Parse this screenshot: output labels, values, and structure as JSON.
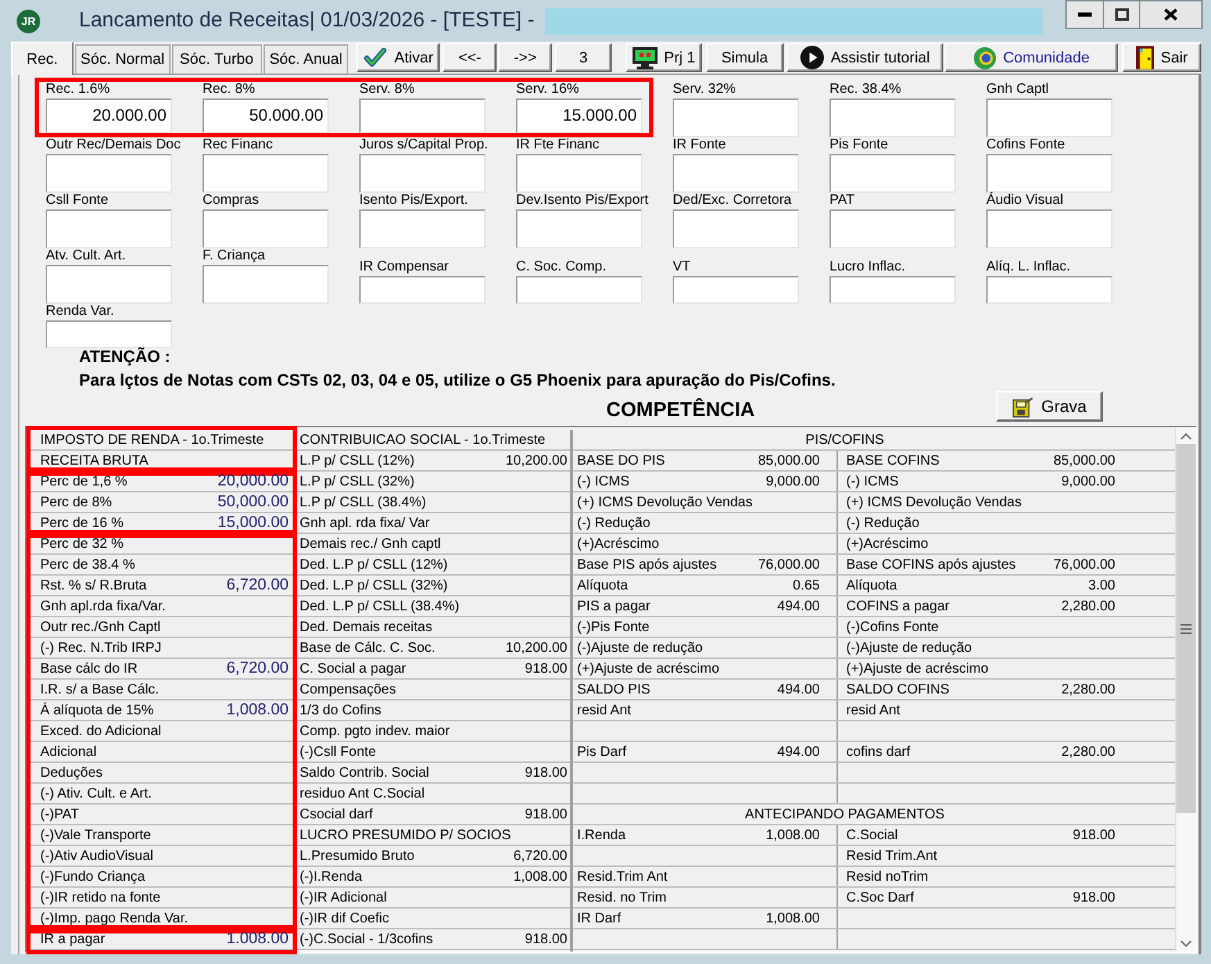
{
  "window": {
    "logo": "JR",
    "title": "Lancamento de Receitas| 01/03/2026 - [TESTE] -"
  },
  "tabs": [
    {
      "label": "Rec.",
      "selected": true
    },
    {
      "label": "Sóc. Normal",
      "selected": false
    },
    {
      "label": "Sóc. Turbo",
      "selected": false
    },
    {
      "label": "Sóc. Anual",
      "selected": false
    }
  ],
  "toolbar": [
    {
      "kind": "check",
      "label": "Ativar"
    },
    {
      "kind": "plain",
      "label": "<<-"
    },
    {
      "kind": "plain",
      "label": "->>"
    },
    {
      "kind": "plain",
      "label": "3"
    },
    {
      "kind": "monitor",
      "label": "Prj 1"
    },
    {
      "kind": "plain",
      "label": "Simula"
    },
    {
      "kind": "play",
      "label": "Assistir tutorial"
    },
    {
      "kind": "community",
      "label": "Comunidade"
    },
    {
      "kind": "exit",
      "label": "Sair"
    }
  ],
  "field_rows": [
    {
      "groups": [
        {
          "highlighted": true,
          "fields": [
            {
              "kind": "tall",
              "label": "Rec. 1.6%",
              "value": "20.000.00"
            },
            {
              "kind": "tall",
              "label": "Rec. 8%",
              "value": "50.000.00"
            },
            {
              "kind": "tall",
              "label": "Serv. 8%"
            },
            {
              "kind": "tall",
              "label": "Serv. 16%",
              "value": "15.000.00"
            }
          ]
        },
        {
          "highlighted": false,
          "fields": [
            {
              "kind": "tall",
              "label": "Serv. 32%"
            },
            {
              "kind": "tall",
              "label": "Rec. 38.4%"
            },
            {
              "kind": "tall",
              "label": "Gnh Captl"
            }
          ]
        }
      ]
    },
    {
      "groups": [
        {
          "highlighted": false,
          "fields": [
            {
              "kind": "tall",
              "label": "Outr Rec/Demais Doc"
            },
            {
              "kind": "tall",
              "label": "Rec Financ"
            },
            {
              "kind": "tall",
              "label": "Juros s/Capital Prop."
            },
            {
              "kind": "tall",
              "label": "IR Fte Financ"
            },
            {
              "kind": "tall",
              "label": "IR Fonte"
            },
            {
              "kind": "tall",
              "label": "Pis Fonte"
            },
            {
              "kind": "tall",
              "label": "Cofins Fonte"
            }
          ]
        }
      ]
    },
    {
      "groups": [
        {
          "highlighted": false,
          "fields": [
            {
              "kind": "tall",
              "label": "Csll Fonte"
            },
            {
              "kind": "tall",
              "label": "Compras"
            },
            {
              "kind": "tall",
              "label": "Isento Pis/Export."
            },
            {
              "kind": "tall",
              "label": "Dev.Isento Pis/Export"
            },
            {
              "kind": "tall",
              "label": "Ded/Exc. Corretora"
            },
            {
              "kind": "tall",
              "label": "PAT"
            },
            {
              "kind": "tall",
              "label": "Áudio Visual"
            }
          ]
        }
      ]
    },
    {
      "groups": [
        {
          "highlighted": false,
          "fields": [
            {
              "kind": "tall",
              "label": "Atv. Cult. Art."
            },
            {
              "kind": "tall",
              "label": "F. Criança"
            },
            {
              "kind": "short",
              "label": "IR Compensar"
            },
            {
              "kind": "short",
              "label": "C. Soc. Comp."
            },
            {
              "kind": "short",
              "label": "VT"
            },
            {
              "kind": "short",
              "label": "Lucro Inflac."
            },
            {
              "kind": "short",
              "label": "Alíq. L. Inflac."
            }
          ]
        }
      ]
    },
    {
      "groups": [
        {
          "highlighted": false,
          "fields": [
            {
              "kind": "short",
              "label": "Renda Var."
            }
          ]
        }
      ]
    }
  ],
  "notice": {
    "title": "ATENÇÃO :",
    "text": "Para lçtos de Notas com CSTs 02, 03, 04 e 05, utilize o G5 Phoenix para apuração do Pis/Cofins."
  },
  "section_title": "COMPETÊNCIA",
  "save_button": {
    "label": "Grava"
  },
  "income_tax": {
    "groups": [
      {
        "highlighted": true,
        "rows": [
          {
            "label": "IMPOSTO DE RENDA - 1o.Trimeste"
          },
          {
            "label": "RECEITA BRUTA"
          }
        ]
      },
      {
        "highlighted": true,
        "rows": [
          {
            "label": "Perc de 1,6 %",
            "value": "20,000.00"
          },
          {
            "label": "Perc de 8%",
            "value": "50,000.00"
          },
          {
            "label": "Perc de 16 %",
            "value": "15,000.00"
          }
        ]
      },
      {
        "highlighted": true,
        "rows": [
          {
            "label": "Perc de 32 %"
          },
          {
            "label": "Perc de 38.4 %"
          },
          {
            "label": "Rst. % s/ R.Bruta",
            "value": "6,720.00"
          },
          {
            "label": "Gnh apl.rda fixa/Var."
          },
          {
            "label": "Outr rec./Gnh Captl"
          },
          {
            "label": "(-) Rec. N.Trib IRPJ"
          },
          {
            "label": "Base cálc do IR",
            "value": "6,720.00"
          },
          {
            "label": "I.R. s/ a Base Cálc."
          },
          {
            "label": "Á alíquota de 15%",
            "value": "1,008.00"
          },
          {
            "label": "Exced. do Adicional"
          },
          {
            "label": "Adicional"
          },
          {
            "label": "Deduções"
          },
          {
            "label": "(-) Ativ. Cult. e Art."
          },
          {
            "label": "(-)PAT"
          },
          {
            "label": "(-)Vale Transporte"
          },
          {
            "label": "(-)Ativ AudioVisual"
          },
          {
            "label": "(-)Fundo Criança"
          },
          {
            "label": "(-)IR retido na fonte"
          },
          {
            "label": "(-)Imp. pago Renda Var."
          }
        ]
      },
      {
        "highlighted": true,
        "rows": [
          {
            "label": "IR a pagar",
            "value": "1.008.00"
          }
        ]
      }
    ]
  },
  "social_contribution": {
    "rows": [
      {
        "label": "CONTRIBUICAO SOCIAL - 1o.Trimeste"
      },
      {
        "label": "L.P p/ CSLL (12%)",
        "value": "10,200.00"
      },
      {
        "label": "L.P p/ CSLL (32%)"
      },
      {
        "label": "L.P p/ CSLL (38.4%)"
      },
      {
        "label": "Gnh apl. rda fixa/ Var"
      },
      {
        "label": "Demais rec./ Gnh captl"
      },
      {
        "label": "Ded. L.P p/ CSLL (12%)"
      },
      {
        "label": "Ded. L.P p/ CSLL (32%)"
      },
      {
        "label": "Ded. L.P p/ CSLL (38.4%)"
      },
      {
        "label": "Ded. Demais receitas"
      },
      {
        "label": "Base de Cálc. C. Soc.",
        "value": "10,200.00"
      },
      {
        "label": "C. Social a pagar",
        "value": "918.00"
      },
      {
        "label": "Compensações"
      },
      {
        "label": "1/3 do Cofins"
      },
      {
        "label": "Comp. pgto indev. maior"
      },
      {
        "label": "(-)Csll Fonte"
      },
      {
        "label": "Saldo Contrib. Social",
        "value": "918.00"
      },
      {
        "label": "residuo Ant C.Social"
      },
      {
        "label": "Csocial darf",
        "value": "918.00"
      },
      {
        "label": "LUCRO PRESUMIDO P/ SOCIOS"
      },
      {
        "label": "L.Presumido Bruto",
        "value": "6,720.00"
      },
      {
        "label": "(-)I.Renda",
        "value": "1,008.00"
      },
      {
        "label": "(-)IR Adicional"
      },
      {
        "label": "(-)IR dif Coefic"
      },
      {
        "label": "(-)C.Social - 1/3cofins",
        "value": "918.00"
      }
    ]
  },
  "pis_cofins": {
    "rows": [
      {
        "kind": "header",
        "label": "PIS/COFINS"
      },
      {
        "kind": "pair",
        "cells": [
          {
            "label": "BASE DO PIS",
            "value": "85,000.00"
          },
          {
            "label": "BASE COFINS",
            "value": "85,000.00"
          }
        ]
      },
      {
        "kind": "pair",
        "cells": [
          {
            "label": "(-) ICMS",
            "value": "9,000.00"
          },
          {
            "label": "(-) ICMS",
            "value": "9,000.00"
          }
        ]
      },
      {
        "kind": "pair",
        "cells": [
          {
            "label": "(+) ICMS Devolução Vendas"
          },
          {
            "label": "(+) ICMS Devolução Vendas"
          }
        ]
      },
      {
        "kind": "pair",
        "cells": [
          {
            "label": "(-) Redução"
          },
          {
            "label": "(-) Redução"
          }
        ]
      },
      {
        "kind": "pair",
        "cells": [
          {
            "label": "(+)Acréscimo"
          },
          {
            "label": "(+)Acréscimo"
          }
        ]
      },
      {
        "kind": "pair",
        "cells": [
          {
            "label": "Base PIS após ajustes",
            "value": "76,000.00"
          },
          {
            "label": "Base COFINS após ajustes",
            "value": "76,000.00"
          }
        ]
      },
      {
        "kind": "pair",
        "cells": [
          {
            "label": "Alíquota",
            "value": "0.65"
          },
          {
            "label": "Alíquota",
            "value": "3.00"
          }
        ]
      },
      {
        "kind": "pair",
        "cells": [
          {
            "label": "PIS a pagar",
            "value": "494.00"
          },
          {
            "label": "COFINS a pagar",
            "value": "2,280.00"
          }
        ]
      },
      {
        "kind": "pair",
        "cells": [
          {
            "label": "(-)Pis Fonte"
          },
          {
            "label": "(-)Cofins Fonte"
          }
        ]
      },
      {
        "kind": "pair",
        "cells": [
          {
            "label": "(-)Ajuste de redução"
          },
          {
            "label": "(-)Ajuste de redução"
          }
        ]
      },
      {
        "kind": "pair",
        "cells": [
          {
            "label": "(+)Ajuste de acréscimo"
          },
          {
            "label": "(+)Ajuste de acréscimo"
          }
        ]
      },
      {
        "kind": "pair",
        "cells": [
          {
            "label": "SALDO PIS",
            "value": "494.00"
          },
          {
            "label": "SALDO COFINS",
            "value": "2,280.00"
          }
        ]
      },
      {
        "kind": "pair",
        "cells": [
          {
            "label": "resid Ant"
          },
          {
            "label": "resid Ant"
          }
        ]
      },
      {
        "kind": "blank"
      },
      {
        "kind": "pair",
        "cells": [
          {
            "label": "Pis Darf",
            "value": "494.00"
          },
          {
            "label": "cofins darf",
            "value": "2,280.00"
          }
        ]
      },
      {
        "kind": "blank"
      },
      {
        "kind": "blank"
      },
      {
        "kind": "header",
        "label": "ANTECIPANDO PAGAMENTOS"
      },
      {
        "kind": "pair",
        "cells": [
          {
            "label": "I.Renda",
            "value": "1,008.00"
          },
          {
            "label": "C.Social",
            "value": "918.00"
          }
        ]
      },
      {
        "kind": "pair",
        "cells": [
          {},
          {
            "label": "Resid Trim.Ant"
          }
        ]
      },
      {
        "kind": "pair",
        "cells": [
          {
            "label": "Resid.Trim Ant"
          },
          {
            "label": "Resid noTrim"
          }
        ]
      },
      {
        "kind": "pair",
        "cells": [
          {
            "label": "Resid. no Trim"
          },
          {
            "label": "C.Soc Darf",
            "value": "918.00"
          }
        ]
      },
      {
        "kind": "pair",
        "cells": [
          {
            "label": "IR Darf",
            "value": "1,008.00"
          },
          {}
        ]
      },
      {
        "kind": "blank"
      }
    ]
  }
}
